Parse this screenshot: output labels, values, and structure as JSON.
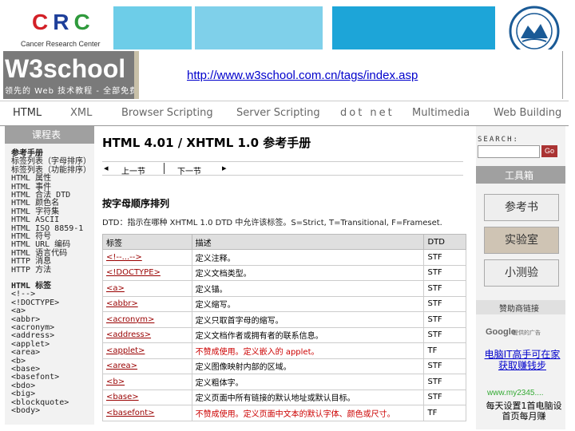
{
  "slide_header": {
    "logo_letters": "CRC",
    "logo_sub": "Cancer Research Center",
    "colors": {
      "c": "#d32027",
      "r": "#1e3f9a",
      "c2": "#2f9a3c"
    }
  },
  "w3": {
    "title": "W3school",
    "tagline": "领先的 Web 技术教程 - 全部免费",
    "url": "http://www.w3school.com.cn/tags/index.asp"
  },
  "nav": {
    "items": [
      "HTML",
      "XML",
      "Browser Scripting",
      "Server Scripting",
      "dot net",
      "Multimedia",
      "Web Building"
    ]
  },
  "left": {
    "header": "课程表",
    "groups": [
      {
        "title": "参考手册",
        "items": [
          "标签列表（字母排序）",
          "标签列表（功能排序）",
          "HTML 属性",
          "HTML 事件",
          "HTML 合法 DTD",
          "HTML 颜色名",
          "HTML 字符集",
          "HTML ASCII",
          "HTML ISO 8859-1",
          "HTML 符号",
          "HTML URL 编码",
          "HTML 语言代码",
          "HTTP 消息",
          "HTTP 方法"
        ]
      },
      {
        "title": "HTML 标签",
        "items": [
          "<!-->",
          "<!DOCTYPE>",
          "<a>",
          "<abbr>",
          "<acronym>",
          "<address>",
          "<applet>",
          "<area>",
          "<b>",
          "<base>",
          "<basefont>",
          "<bdo>",
          "<big>",
          "<blockquote>",
          "<body>"
        ]
      }
    ]
  },
  "main": {
    "title": "HTML 4.01 / XHTML 1.0 参考手册",
    "prev": "上一节",
    "next": "下一节",
    "section": "按字母顺序排列",
    "dtd_note": "DTD：指示在哪种 XHTML 1.0 DTD 中允许该标签。S=Strict, T=Transitional, F=Frameset.",
    "table": {
      "headers": [
        "标签",
        "描述",
        "DTD"
      ],
      "rows": [
        {
          "tag": "<!--...-->",
          "desc": "定义注释。",
          "dtd": "STF",
          "deprecated": false
        },
        {
          "tag": "<!DOCTYPE>",
          "desc": "定义文档类型。",
          "dtd": "STF",
          "deprecated": false
        },
        {
          "tag": "<a>",
          "desc": "定义锚。",
          "dtd": "STF",
          "deprecated": false
        },
        {
          "tag": "<abbr>",
          "desc": "定义缩写。",
          "dtd": "STF",
          "deprecated": false
        },
        {
          "tag": "<acronym>",
          "desc": "定义只取首字母的缩写。",
          "dtd": "STF",
          "deprecated": false
        },
        {
          "tag": "<address>",
          "desc": "定义文档作者或拥有者的联系信息。",
          "dtd": "STF",
          "deprecated": false
        },
        {
          "tag": "<applet>",
          "desc": "不赞成使用。定义嵌入的 applet。",
          "dtd": "TF",
          "deprecated": true
        },
        {
          "tag": "<area>",
          "desc": "定义图像映射内部的区域。",
          "dtd": "STF",
          "deprecated": false
        },
        {
          "tag": "<b>",
          "desc": "定义粗体字。",
          "dtd": "STF",
          "deprecated": false
        },
        {
          "tag": "<base>",
          "desc": "定义页面中所有链接的默认地址或默认目标。",
          "dtd": "STF",
          "deprecated": false
        },
        {
          "tag": "<basefont>",
          "desc": "不赞成使用。定义页面中文本的默认字体、颜色或尺寸。",
          "dtd": "TF",
          "deprecated": true
        }
      ]
    }
  },
  "right": {
    "search_label": "SEARCH:",
    "go": "Go",
    "tools_header": "工具箱",
    "tools": [
      "参考书",
      "实验室",
      "小测验"
    ],
    "sponsor_header": "赞助商链接",
    "google": "Google",
    "google_sub": "提供的广告",
    "ad1": "电脑IT高手可在家获取赚钱步",
    "ad_url": "www.my2345....",
    "ad2": "每天设置1首电脑设首页每月赚"
  }
}
